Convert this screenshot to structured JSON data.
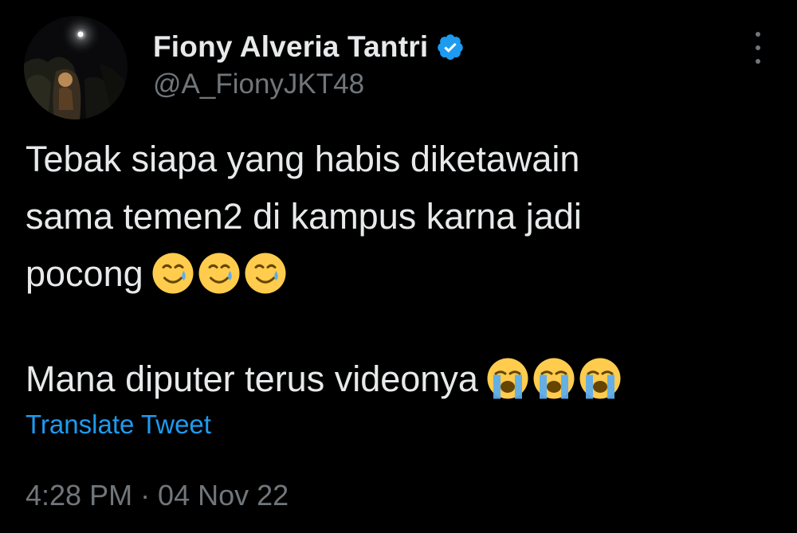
{
  "author": {
    "display_name": "Fiony Alveria Tantri",
    "handle": "@A_FionyJKT48",
    "verified": true,
    "verified_color": "#1d9bf0"
  },
  "tweet": {
    "lines": [
      "Tebak siapa yang habis diketawain",
      "sama temen2 di kampus karna jadi",
      "pocong"
    ],
    "line2": "Mana diputer terus videonya",
    "emojis_1": [
      "smiling-face-with-tear",
      "smiling-face-with-tear",
      "smiling-face-with-tear"
    ],
    "emojis_2": [
      "loudly-crying-face",
      "loudly-crying-face",
      "loudly-crying-face"
    ]
  },
  "translate_label": "Translate Tweet",
  "timestamp": "4:28 PM · 04 Nov 22",
  "colors": {
    "background": "#000000",
    "text": "#e7e9ea",
    "muted": "#71767b",
    "accent": "#1d9bf0"
  }
}
